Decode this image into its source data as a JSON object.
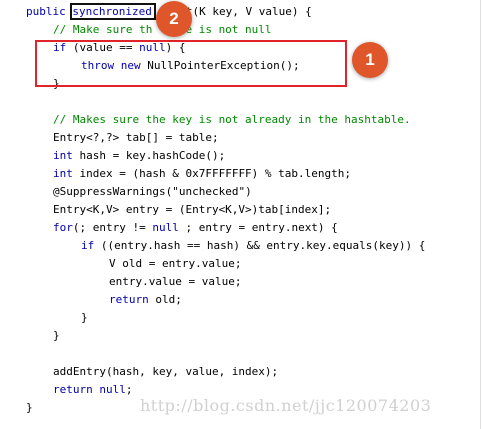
{
  "badges": {
    "two": "2",
    "one": "1"
  },
  "watermark": "http://blog.csdn.net/jjc120074203",
  "code": {
    "l1_kw": "public",
    "l1_sync": "synchronized",
    "l1_rest": "t(K key, V value) {",
    "l2": "// Make sure th   lue is not null",
    "l3_kw": "if",
    "l3_a": " (value == ",
    "l3_null": "null",
    "l3_b": ") {",
    "l4_throw": "throw",
    "l4_sp": " ",
    "l4_new": "new",
    "l4_rest": " NullPointerException();",
    "l5": "}",
    "l6": "// Makes sure the key is not already in the hashtable.",
    "l7": "Entry<?,?> tab[] = table;",
    "l8_kw": "int",
    "l8_rest": " hash = key.hashCode();",
    "l9_kw": "int",
    "l9_rest": " index = (hash & 0x7FFFFFFF) % tab.length;",
    "l10_a": "@SuppressWarnings(",
    "l10_str": "\"unchecked\"",
    "l10_b": ")",
    "l11": "Entry<K,V> entry = (Entry<K,V>)tab[index];",
    "l12_kw": "for",
    "l12_a": "(; entry != ",
    "l12_null": "null",
    "l12_b": " ; entry = entry.next) {",
    "l13_kw": "if",
    "l13_rest": " ((entry.hash == hash) && entry.key.equals(key)) {",
    "l14": "V old = entry.value;",
    "l15": "entry.value = value;",
    "l16_kw": "return",
    "l16_rest": " old;",
    "l17": "}",
    "l18": "}",
    "l19": "addEntry(hash, key, value, index);",
    "l20_kw": "return",
    "l20_sp": " ",
    "l20_null": "null",
    "l20_rest": ";",
    "l21": "}"
  },
  "colors": {
    "keyword": "#0000aa",
    "comment": "#008800",
    "badge": "#e0562b",
    "red_box": "#e0242a"
  }
}
